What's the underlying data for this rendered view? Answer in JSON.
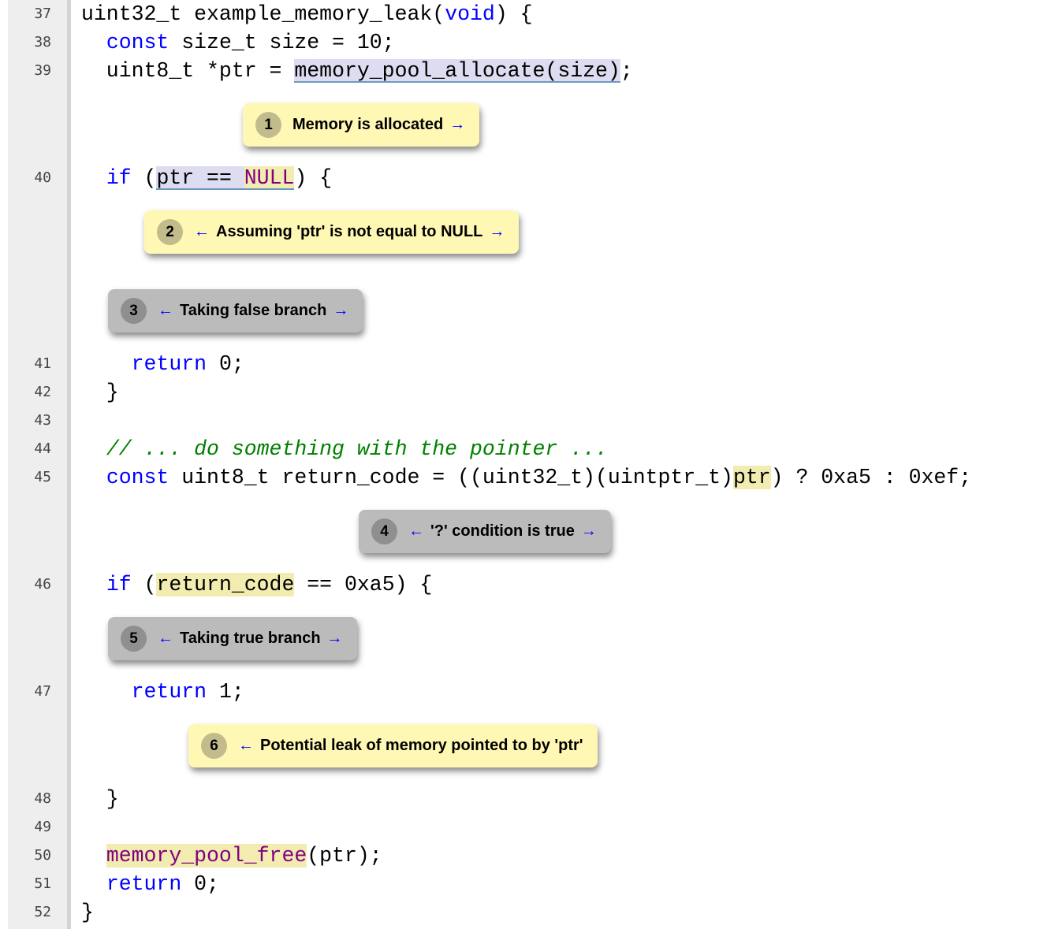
{
  "colors": {
    "keyword": "#0000ff",
    "comment": "#008000",
    "macro": "#800080",
    "event_note": "#fff8b4",
    "control_note": "#bbbbbb"
  },
  "rows": [
    {
      "type": "code",
      "num": "37",
      "segs": [
        {
          "t": "uint32_t example_memory_leak("
        },
        {
          "t": "void",
          "c": "kw"
        },
        {
          "t": ") {"
        }
      ]
    },
    {
      "type": "code",
      "num": "38",
      "segs": [
        {
          "t": "  "
        },
        {
          "t": "const",
          "c": "kw"
        },
        {
          "t": " size_t size = 10;"
        }
      ]
    },
    {
      "type": "code",
      "num": "39",
      "segs": [
        {
          "t": "  uint8_t *ptr = "
        },
        {
          "t": "memory_pool_allocate(size)",
          "c": "hlv"
        },
        {
          "t": ";"
        }
      ]
    },
    {
      "type": "note",
      "kind": "event",
      "n": "1",
      "text": "Memory is allocated",
      "left": false,
      "right": true,
      "indent": 308
    },
    {
      "type": "code",
      "num": "40",
      "segs": [
        {
          "t": "  "
        },
        {
          "t": "if",
          "c": "kw"
        },
        {
          "t": " ("
        },
        {
          "t": "ptr == ",
          "c": "hlv"
        },
        {
          "t": "NULL",
          "c": "hly mac hlvline"
        },
        {
          "t": ") {"
        }
      ]
    },
    {
      "type": "note",
      "kind": "event",
      "n": "2",
      "text": "Assuming 'ptr' is not equal to NULL",
      "left": true,
      "right": true,
      "indent": 183
    },
    {
      "type": "note",
      "kind": "control",
      "n": "3",
      "text": "Taking false branch",
      "left": true,
      "right": true,
      "indent": 137
    },
    {
      "type": "code",
      "num": "41",
      "segs": [
        {
          "t": "    "
        },
        {
          "t": "return",
          "c": "kw"
        },
        {
          "t": " 0;"
        }
      ]
    },
    {
      "type": "code",
      "num": "42",
      "segs": [
        {
          "t": "  }"
        }
      ]
    },
    {
      "type": "code",
      "num": "43",
      "segs": [
        {
          "t": ""
        }
      ]
    },
    {
      "type": "code",
      "num": "44",
      "segs": [
        {
          "t": "  "
        },
        {
          "t": "// ... do something with the pointer ...",
          "c": "cm"
        }
      ]
    },
    {
      "type": "code",
      "num": "45",
      "segs": [
        {
          "t": "  "
        },
        {
          "t": "const",
          "c": "kw"
        },
        {
          "t": " uint8_t return_code = ((uint32_t)(uintptr_t)"
        },
        {
          "t": "ptr",
          "c": "hly"
        },
        {
          "t": ") ? 0xa5 : 0xef;"
        }
      ]
    },
    {
      "type": "note",
      "kind": "control",
      "n": "4",
      "text": "'?' condition is true",
      "left": true,
      "right": true,
      "indent": 455
    },
    {
      "type": "code",
      "num": "46",
      "segs": [
        {
          "t": "  "
        },
        {
          "t": "if",
          "c": "kw"
        },
        {
          "t": " ("
        },
        {
          "t": "return_code",
          "c": "hly"
        },
        {
          "t": " == 0xa5) {"
        }
      ]
    },
    {
      "type": "note",
      "kind": "control",
      "n": "5",
      "text": "Taking true branch",
      "left": true,
      "right": true,
      "indent": 137
    },
    {
      "type": "code",
      "num": "47",
      "segs": [
        {
          "t": "    "
        },
        {
          "t": "return",
          "c": "kw"
        },
        {
          "t": " 1;"
        }
      ]
    },
    {
      "type": "note",
      "kind": "event",
      "n": "6",
      "text": "Potential leak of memory pointed to by 'ptr'",
      "left": true,
      "right": false,
      "indent": 239
    },
    {
      "type": "code",
      "num": "48",
      "segs": [
        {
          "t": "  }"
        }
      ]
    },
    {
      "type": "code",
      "num": "49",
      "segs": [
        {
          "t": ""
        }
      ]
    },
    {
      "type": "code",
      "num": "50",
      "segs": [
        {
          "t": "  "
        },
        {
          "t": "memory_pool_free",
          "c": "hly mac"
        },
        {
          "t": "(ptr);"
        }
      ]
    },
    {
      "type": "code",
      "num": "51",
      "segs": [
        {
          "t": "  "
        },
        {
          "t": "return",
          "c": "kw"
        },
        {
          "t": " 0;"
        }
      ]
    },
    {
      "type": "code",
      "num": "52",
      "segs": [
        {
          "t": "}"
        }
      ]
    }
  ],
  "arrows": {
    "left": "←",
    "right": "→"
  }
}
